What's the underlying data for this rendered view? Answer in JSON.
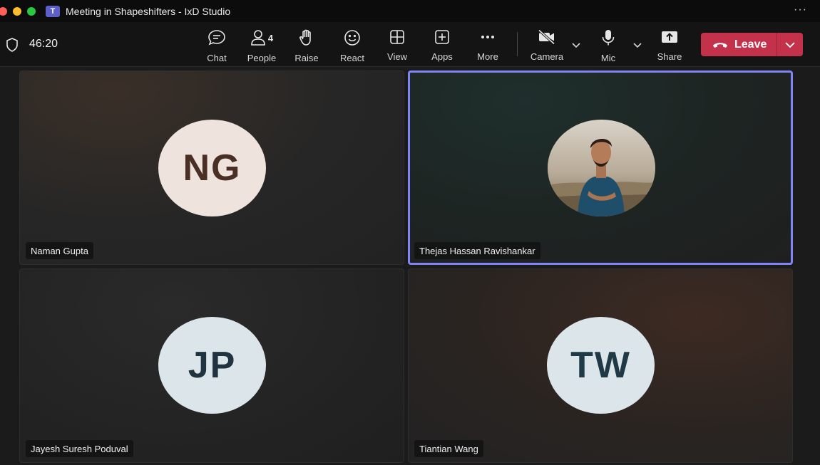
{
  "window": {
    "title": "Meeting in Shapeshifters - IxD Studio",
    "app_icon": "teams-logo-icon",
    "app_icon_letter": "T",
    "more_label": "···"
  },
  "toolbar": {
    "timer": "46:20",
    "people_count": "4",
    "buttons": {
      "chat": "Chat",
      "people": "People",
      "raise": "Raise",
      "react": "React",
      "view": "View",
      "apps": "Apps",
      "more": "More",
      "camera": "Camera",
      "mic": "Mic",
      "share": "Share"
    },
    "leave_label": "Leave"
  },
  "participants": [
    {
      "name": "Naman Gupta",
      "initials": "NG",
      "avatar_type": "initials"
    },
    {
      "name": "Thejas Hassan Ravishankar",
      "initials": "",
      "avatar_type": "photo",
      "active_speaker": true
    },
    {
      "name": "Jayesh Suresh Poduval",
      "initials": "JP",
      "avatar_type": "initials"
    },
    {
      "name": "Tiantian Wang",
      "initials": "TW",
      "avatar_type": "initials"
    }
  ],
  "colors": {
    "leave": "#c4314b",
    "active_border": "#7f85f5",
    "teams_brand": "#5b5fc7"
  }
}
